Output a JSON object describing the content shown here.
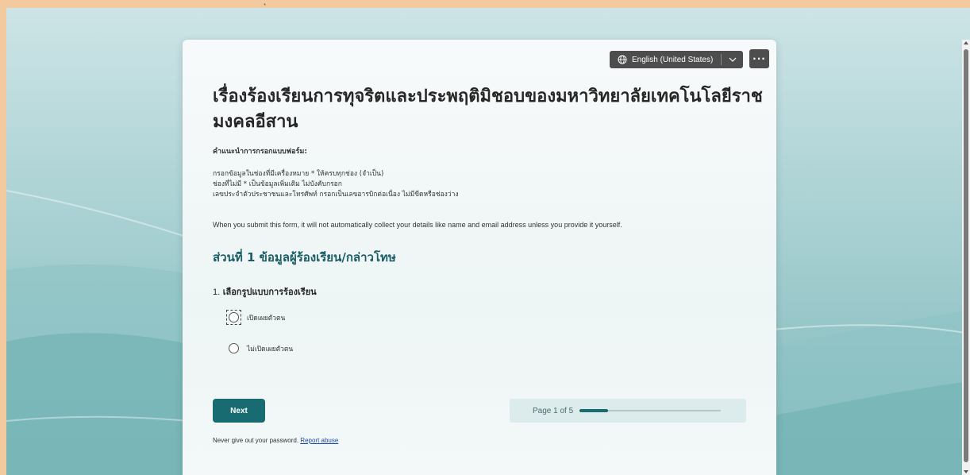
{
  "window": {
    "top_fragment": "ุ"
  },
  "form": {
    "language_selector": "English (United States)",
    "more_label": "···",
    "title_line1": "เรื่องร้องเรียนการทุจริตและประพฤติมิชอบของมหาวิทยาลัยเทคโนโลยีราช",
    "title_line2": "มงคลอีสาน",
    "instructions_heading": "คำแนะนำการกรอกแบบฟอร์ม:",
    "instructions": [
      "กรอกข้อมูลในช่องที่มีเครื่องหมาย * ให้ครบทุกช่อง (จำเป็น)",
      "ช่องที่ไม่มี * เป็นข้อมูลเพิ่มเติม ไม่บังคับกรอก",
      "เลขประจำตัวประชาชนและโทรศัพท์ กรอกเป็นเลขอารบิกต่อเนื่อง ไม่มีขีดหรือช่องว่าง"
    ],
    "privacy_notice": "When you submit this form, it will not automatically collect your details like name and email address unless you provide it yourself.",
    "section_title": "ส่วนที่ 1 ข้อมูลผู้ร้องเรียน/กล่าวโทษ",
    "question": {
      "number": "1.",
      "text": "เลือกรูปแบบการร้องเรียน",
      "options": [
        "เปิดเผยตัวตน",
        "ไม่เปิดเผยตัวตน"
      ]
    },
    "next_label": "Next",
    "page_indicator": "Page 1 of 5",
    "progress_fraction": 0.2,
    "footer_text": "Never give out your password.",
    "report_abuse_label": "Report abuse"
  },
  "colors": {
    "accent": "#186b70",
    "card": "#f4f8f8",
    "frame": "#f3c9a0"
  }
}
